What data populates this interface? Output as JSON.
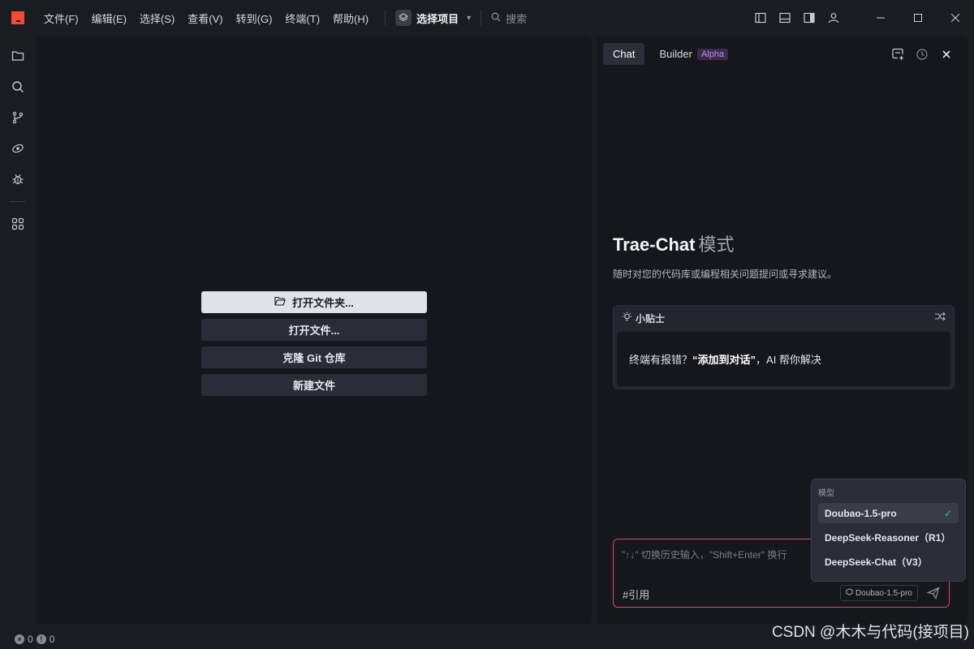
{
  "menu": [
    "文件(F)",
    "编辑(E)",
    "选择(S)",
    "查看(V)",
    "转到(G)",
    "终端(T)",
    "帮助(H)"
  ],
  "project": {
    "label": "选择项目"
  },
  "search": {
    "label": "搜索"
  },
  "welcome": {
    "open_folder": "打开文件夹...",
    "open_file": "打开文件...",
    "clone_git": "克隆 Git 仓库",
    "new_file": "新建文件"
  },
  "chat": {
    "tabs": {
      "chat": "Chat",
      "builder": "Builder",
      "alpha": "Alpha"
    },
    "title": "Trae-Chat",
    "title_mode": "模式",
    "description": "随时对您的代码库或编程相关问题提问或寻求建议。",
    "tips": {
      "header": "小贴士",
      "body_prefix": "终端有报错？",
      "body_bold": "“添加到对话”",
      "body_suffix": "，AI 帮你解决"
    },
    "input": {
      "placeholder": "\"↑↓\" 切换历史输入，\"Shift+Enter\" 换行",
      "reference": "#引用",
      "model": "Doubao-1.5-pro"
    }
  },
  "model_dropdown": {
    "title": "模型",
    "options": [
      "Doubao-1.5-pro",
      "DeepSeek-Reasoner（R1）",
      "DeepSeek-Chat（V3）"
    ],
    "selected_index": 0
  },
  "status": {
    "errors": "0",
    "warnings": "0"
  },
  "watermark": "CSDN @木木与代码(接项目)",
  "colors": {
    "accent_red": "#f14c35",
    "input_border": "#d94b67",
    "check_green": "#3fbf7f"
  }
}
